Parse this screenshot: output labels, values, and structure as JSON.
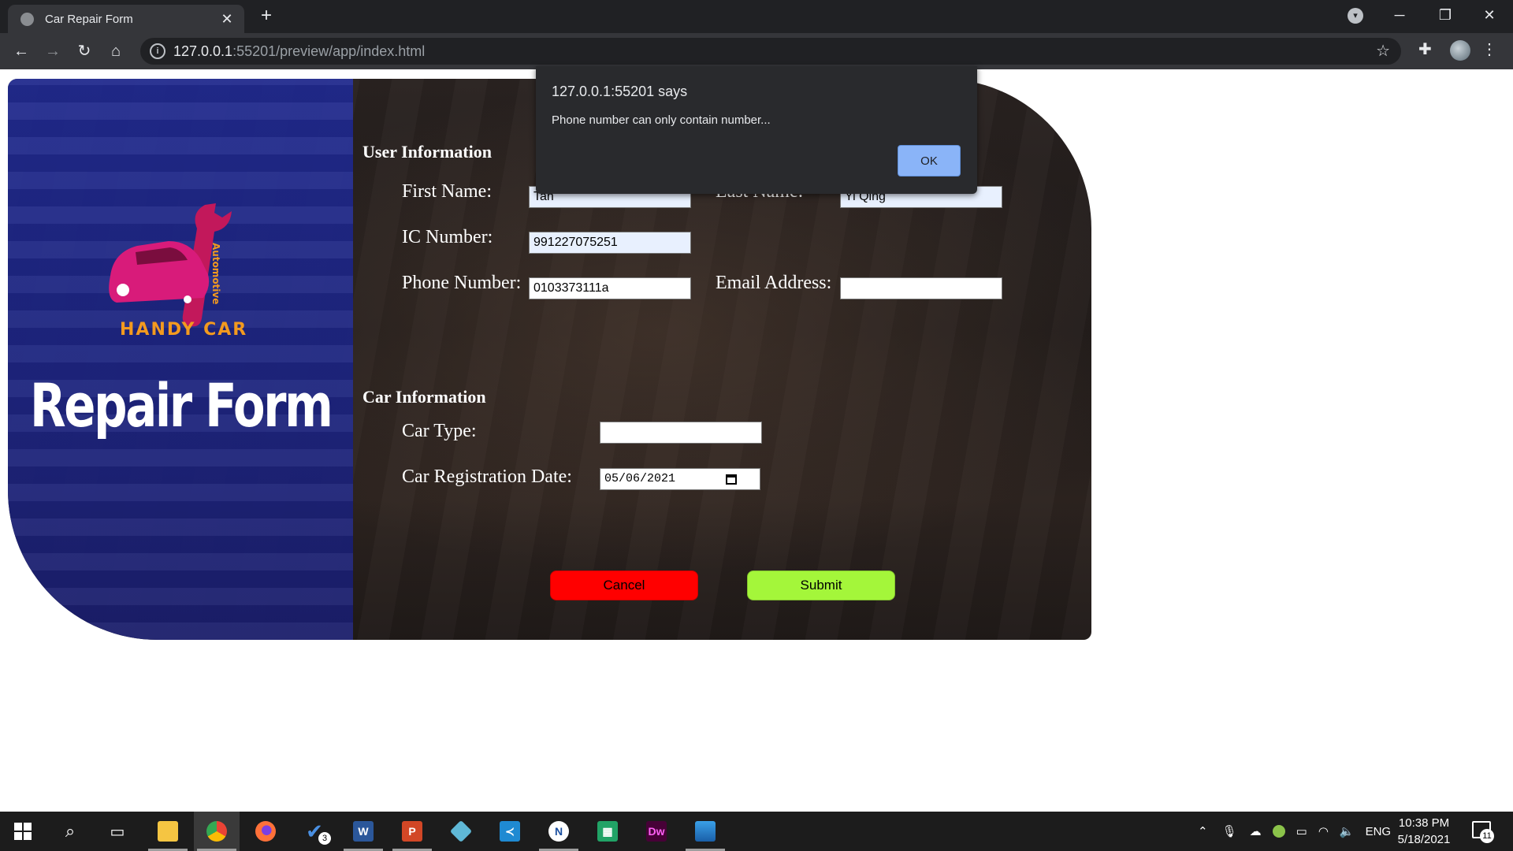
{
  "browser": {
    "tab_title": "Car Repair Form",
    "url_host": "127.0.0.1",
    "url_path": ":55201/preview/app/index.html"
  },
  "page": {
    "brand": "HANDY CAR",
    "brand_vertical": "Automotive",
    "heading": "Repair Form",
    "user_section": {
      "title": "User Information",
      "first_name_label": "First Name:",
      "first_name_value": "Tan",
      "last_name_label": "Last Name:",
      "last_name_value": "Yi Qing",
      "ic_label": "IC Number:",
      "ic_value": "991227075251",
      "phone_label": "Phone Number:",
      "phone_value": "0103373111a",
      "email_label": "Email Address:",
      "email_value": ""
    },
    "car_section": {
      "title": "Car Information",
      "car_type_label": "Car Type:",
      "car_type_value": "",
      "reg_date_label": "Car Registration Date:",
      "reg_date_value": "05/06/2021"
    },
    "buttons": {
      "cancel": "Cancel",
      "submit": "Submit"
    },
    "colors": {
      "cancel": "#ff0000",
      "submit": "#a4f63a",
      "left_panel": "#2430a0"
    }
  },
  "alert": {
    "title": "127.0.0.1:55201 says",
    "message": "Phone number can only contain number...",
    "ok": "OK"
  },
  "taskbar": {
    "apps": [
      "file-explorer",
      "chrome",
      "firefox",
      "todo",
      "word",
      "powerpoint",
      "3d-app",
      "vscode",
      "notepad-app",
      "project-app",
      "dreamweaver",
      "photos"
    ],
    "todo_badge": "3",
    "language": "ENG",
    "time": "10:38 PM",
    "date": "5/18/2021",
    "notification_count": "11"
  }
}
